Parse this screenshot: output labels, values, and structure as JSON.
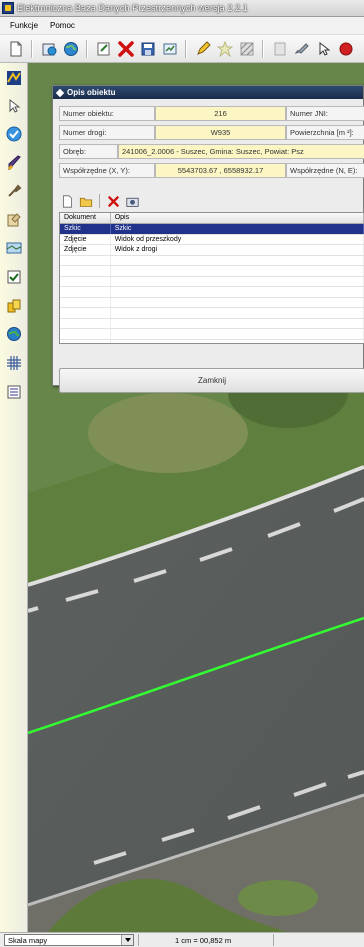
{
  "window": {
    "title": "Elektroniczna Baza Danych Przestrzennych wersja 2.2.1"
  },
  "menu": {
    "items": [
      "Funkcje",
      "Pomoc"
    ]
  },
  "dialog": {
    "title": "Opis obiektu",
    "fields": {
      "numer_obiektu_label": "Numer obiektu:",
      "numer_obiektu_value": "216",
      "numer_jni_label": "Numer JNI:",
      "numer_drogi_label": "Numer drogi:",
      "numer_drogi_value": "W935",
      "powierzchnia_label": "Powierzchnia [m ²]:",
      "obreb_label": "Obręb:",
      "obreb_value": "241006_2.0006 - Suszec, Gmina: Suszec, Powiat: Psz",
      "wsp_xy_label": "Współrzędne (X, Y):",
      "wsp_xy_value": "5543703.67 , 6558932.17",
      "wsp_ne_label": "Współrzędne (N, E):"
    },
    "table": {
      "headers": [
        "Dokument",
        "Opis"
      ],
      "rows": [
        {
          "dokument": "Szkic",
          "opis": "Szkic"
        },
        {
          "dokument": "Zdjęcie",
          "opis": "Widok od przeszkody"
        },
        {
          "dokument": "Zdjęcie",
          "opis": "Widok z drogi"
        }
      ],
      "selected_index": 0
    },
    "close_label": "Zamknij"
  },
  "statusbar": {
    "scale_select_value": "Skala mapy",
    "scale_text": "1 cm = 00,852 m"
  },
  "colors": {
    "title_bar": "#2f4a70",
    "field_highlight": "#fcf6c4",
    "selection": "#20328a",
    "map_line": "#33ff33"
  },
  "icons": {
    "toolbar": [
      "new-document-icon",
      "open-file-icon",
      "globe-icon",
      "edit-form-icon",
      "delete-icon",
      "save-icon",
      "export-icon",
      "pencil-icon",
      "star-icon",
      "hatch-icon",
      "layers-icon",
      "brush-icon",
      "pointer-icon",
      "red-marker-icon"
    ],
    "sidebar": [
      "logo-icon",
      "cursor-icon",
      "checkmark-icon",
      "brush-icon",
      "tool-icon",
      "layer-icon",
      "map-icon",
      "checkbox-icon",
      "database-icon",
      "globe-icon",
      "grid-icon",
      "list-icon"
    ]
  }
}
